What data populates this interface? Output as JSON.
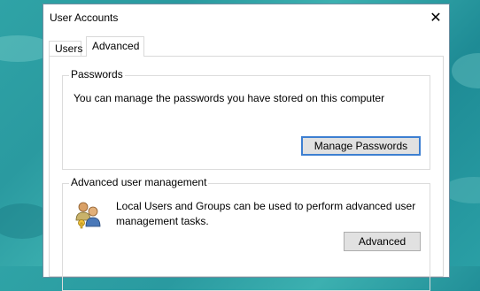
{
  "window": {
    "title": "User Accounts"
  },
  "tabs": [
    {
      "label": "Users",
      "active": false
    },
    {
      "label": "Advanced",
      "active": true
    }
  ],
  "passwords": {
    "group_label": "Passwords",
    "description": "You can manage the passwords you have stored on this computer",
    "button_label": "Manage Passwords"
  },
  "advanced_mgmt": {
    "group_label": "Advanced user management",
    "description": "Local Users and Groups can be used to perform advanced user management tasks.",
    "button_label": "Advanced",
    "icon": "users-groups-icon"
  },
  "colors": {
    "accent": "#3d7fd1",
    "desktop": "#2fa3a6"
  }
}
